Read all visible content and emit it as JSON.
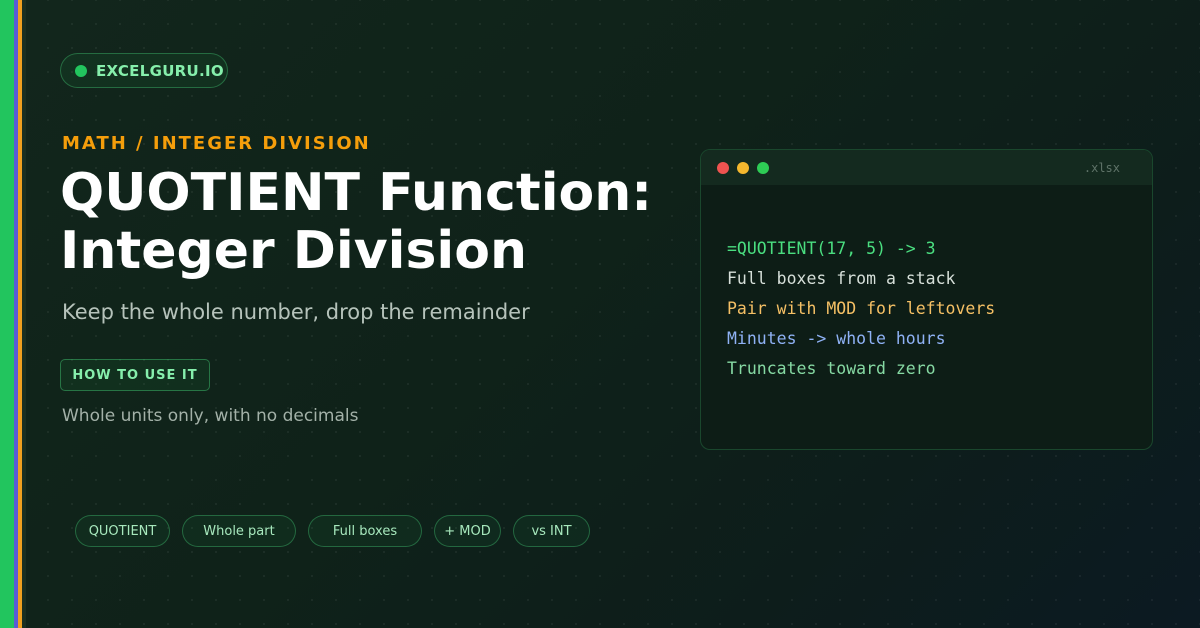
{
  "brand": {
    "label": "EXCELGURU.IO"
  },
  "kicker": "MATH / INTEGER DIVISION",
  "title": {
    "line1": "QUOTIENT Function:",
    "line2": "Integer Division"
  },
  "subtitle": "Keep the whole number, drop the remainder",
  "cta": {
    "label": "HOW TO USE IT"
  },
  "note": "Whole units only, with no decimals",
  "tags": [
    "QUOTIENT",
    "Whole part",
    "Full boxes",
    "+ MOD",
    "vs INT"
  ],
  "window": {
    "file_ext": ".xlsx",
    "lines": [
      {
        "text": "=QUOTIENT(17, 5) -> 3",
        "color": "#4ade80"
      },
      {
        "text": "Full boxes from a stack",
        "color": "#d6dfd9"
      },
      {
        "text": "Pair with MOD for leftovers",
        "color": "#f5c065"
      },
      {
        "text": "Minutes -> whole hours",
        "color": "#8fb2f5"
      },
      {
        "text": "Truncates toward zero",
        "color": "#86d9a3"
      }
    ]
  },
  "colors": {
    "accent_green": "#22c55e",
    "accent_gold": "#f59e0b",
    "accent_indigo": "#5b5bd6"
  }
}
